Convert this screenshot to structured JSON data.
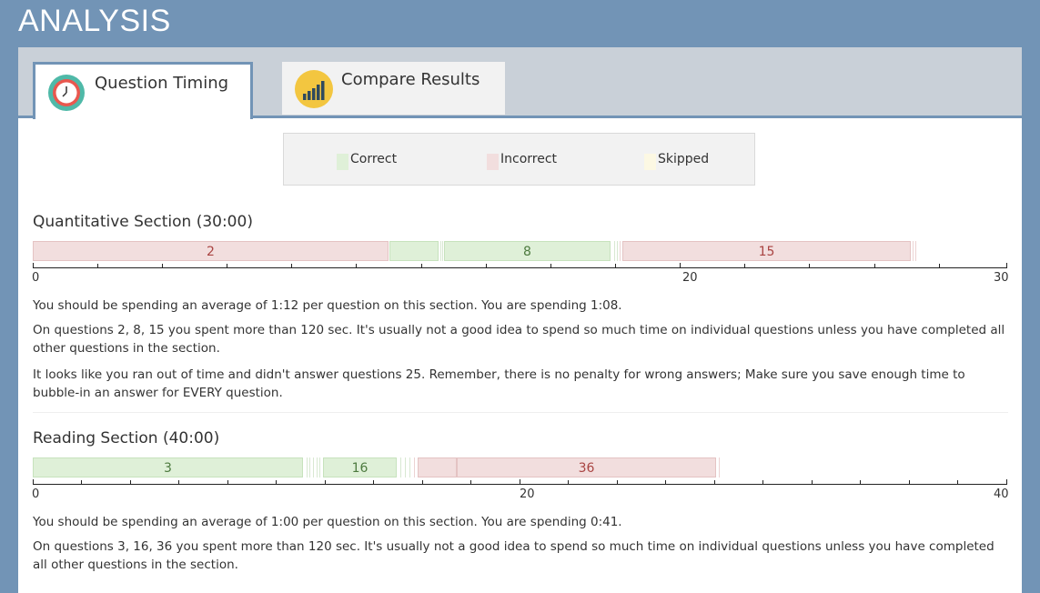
{
  "page_title": "ANALYSIS",
  "tabs": [
    {
      "label": "Question Timing",
      "icon": "clock-icon",
      "active": true
    },
    {
      "label": "Compare Results",
      "icon": "bar-chart-icon",
      "active": false
    }
  ],
  "legend": {
    "correct": "Correct",
    "incorrect": "Incorrect",
    "skipped": "Skipped",
    "colors": {
      "correct": "#dff0d8",
      "incorrect": "#f2dede",
      "skipped": "#fcf8e3"
    }
  },
  "sections": [
    {
      "title": "Quantitative Section (30:00)",
      "axis_max": 30,
      "axis_labels": [
        "0",
        "20",
        "30"
      ],
      "segment_labels": [
        "2",
        "8",
        "15"
      ],
      "messages": [
        "You should be spending an average of 1:12 per question on this section. You are spending 1:08.",
        "On questions 2, 8, 15 you spent more than 120 sec. It's usually not a good idea to spend so much time on individual questions unless you have completed all other questions in the section.",
        "It looks like you ran out of time and didn't answer questions 25. Remember, there is no penalty for wrong answers; Make sure you save enough time to bubble-in an answer for EVERY question."
      ]
    },
    {
      "title": "Reading Section (40:00)",
      "axis_max": 40,
      "axis_labels": [
        "0",
        "20",
        "40"
      ],
      "segment_labels": [
        "3",
        "16",
        "36"
      ],
      "messages": [
        "You should be spending an average of 1:00 per question on this section. You are spending 0:41.",
        "On questions 3, 16, 36 you spent more than 120 sec. It's usually not a good idea to spend so much time on individual questions unless you have completed all other questions in the section."
      ]
    }
  ]
}
